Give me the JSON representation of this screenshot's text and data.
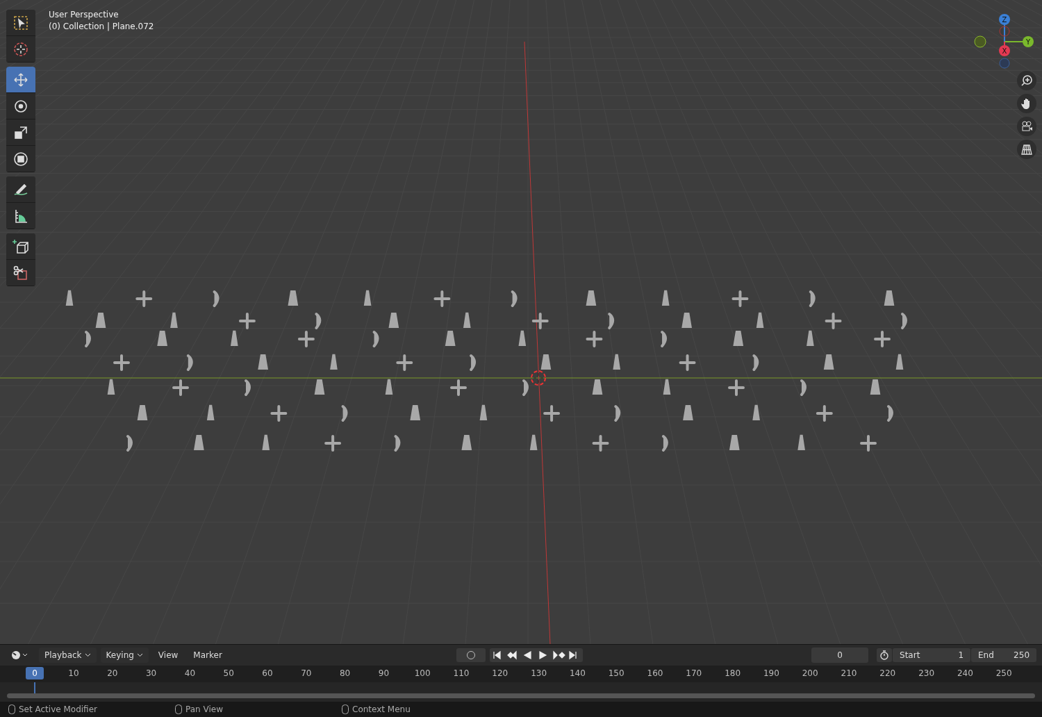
{
  "viewport": {
    "view_name": "User Perspective",
    "object_info": "(0) Collection | Plane.072"
  },
  "toolbar": {
    "groups": [
      [
        {
          "kind": "select",
          "selected": false
        },
        {
          "kind": "cursor",
          "selected": false
        }
      ],
      [
        {
          "kind": "move",
          "selected": true
        },
        {
          "kind": "rotate",
          "selected": false
        },
        {
          "kind": "scale",
          "selected": false
        },
        {
          "kind": "transform",
          "selected": false
        }
      ],
      [
        {
          "kind": "annotate",
          "selected": false
        },
        {
          "kind": "measure",
          "selected": false
        }
      ],
      [
        {
          "kind": "add_cube",
          "selected": false
        },
        {
          "kind": "cut",
          "selected": false
        }
      ]
    ]
  },
  "gizmo": {
    "axis_labels": {
      "z": "Z",
      "y": "Y",
      "x": "X"
    }
  },
  "timeline": {
    "menus": [
      {
        "label": "Playback",
        "dropdown": true
      },
      {
        "label": "Keying",
        "dropdown": true
      },
      {
        "label": "View",
        "dropdown": false
      },
      {
        "label": "Marker",
        "dropdown": false
      }
    ],
    "current_frame": "0",
    "start_label": "Start",
    "start": "1",
    "end_label": "End",
    "end": "250",
    "playhead": "0",
    "ticks": [
      "10",
      "20",
      "30",
      "40",
      "50",
      "60",
      "70",
      "80",
      "90",
      "100",
      "110",
      "120",
      "130",
      "140",
      "150",
      "160",
      "170",
      "180",
      "190",
      "200",
      "210",
      "220",
      "230",
      "240",
      "250"
    ]
  },
  "status_bar": [
    "Set Active Modifier",
    "Pan View",
    "Context Menu"
  ]
}
